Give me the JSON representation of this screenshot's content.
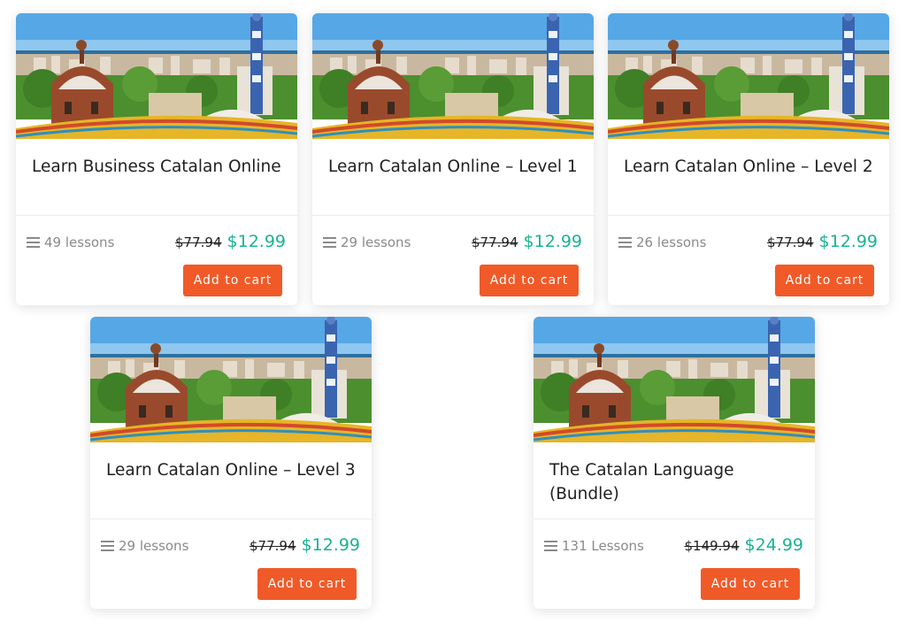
{
  "courses": [
    {
      "title": "Learn Business Catalan Online",
      "lessons": "49 lessons",
      "old_price": "$77.94",
      "price": "$12.99",
      "cta": "Add to cart"
    },
    {
      "title": "Learn Catalan Online – Level 1",
      "lessons": "29 lessons",
      "old_price": "$77.94",
      "price": "$12.99",
      "cta": "Add to cart"
    },
    {
      "title": "Learn Catalan Online – Level 2",
      "lessons": "26 lessons",
      "old_price": "$77.94",
      "price": "$12.99",
      "cta": "Add to cart"
    },
    {
      "title": "Learn Catalan Online – Level 3",
      "lessons": "29 lessons",
      "old_price": "$77.94",
      "price": "$12.99",
      "cta": "Add to cart"
    },
    {
      "title": "The Catalan Language (Bundle)",
      "lessons": "131 Lessons",
      "old_price": "$149.94",
      "price": "$24.99",
      "cta": "Add to cart"
    }
  ],
  "colors": {
    "price": "#19b394",
    "button": "#f05a28"
  },
  "icons": {
    "lessons": "menu-lines-icon"
  }
}
